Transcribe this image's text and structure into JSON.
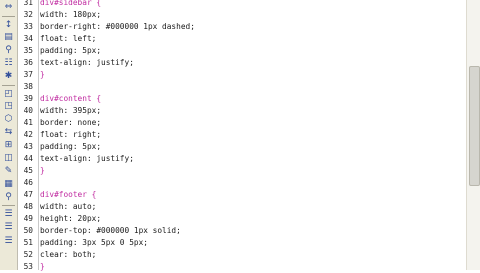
{
  "toolbar": {
    "icons": [
      {
        "name": "expand-icon",
        "glyph": "⇔"
      },
      {
        "name": "collapse-icon",
        "glyph": "↕"
      },
      {
        "name": "select-icon",
        "glyph": "▤"
      },
      {
        "name": "link-icon",
        "glyph": "⚲"
      },
      {
        "name": "wrap-icon",
        "glyph": "☷"
      },
      {
        "name": "indent-icon",
        "glyph": "✱"
      },
      {
        "name": "comment-icon",
        "glyph": "◰"
      },
      {
        "name": "uncomment-icon",
        "glyph": "◳"
      },
      {
        "name": "snippet-icon",
        "glyph": "⬡"
      },
      {
        "name": "highlight-icon",
        "glyph": "⇆"
      },
      {
        "name": "format-icon",
        "glyph": "⊞"
      },
      {
        "name": "apply-icon",
        "glyph": "◫"
      },
      {
        "name": "edit-icon",
        "glyph": "✎"
      },
      {
        "name": "validate-icon",
        "glyph": "▦"
      },
      {
        "name": "search-icon",
        "glyph": "⚲"
      },
      {
        "name": "outdent-icon",
        "glyph": "☰"
      },
      {
        "name": "indent-more-icon",
        "glyph": "☰"
      },
      {
        "name": "list-icon",
        "glyph": "☰"
      }
    ]
  },
  "editor": {
    "lines": [
      {
        "num": "31",
        "text": "div#sidebar {",
        "kind": "selector"
      },
      {
        "num": "32",
        "text": "width: 180px;",
        "kind": "prop"
      },
      {
        "num": "33",
        "text": "border-right: #000000 1px dashed;",
        "kind": "prop"
      },
      {
        "num": "34",
        "text": "float: left;",
        "kind": "prop"
      },
      {
        "num": "35",
        "text": "padding: 5px;",
        "kind": "prop"
      },
      {
        "num": "36",
        "text": "text-align: justify;",
        "kind": "prop"
      },
      {
        "num": "37",
        "text": "}",
        "kind": "brace"
      },
      {
        "num": "38",
        "text": "",
        "kind": "prop"
      },
      {
        "num": "39",
        "text": "div#content {",
        "kind": "selector"
      },
      {
        "num": "40",
        "text": "width: 395px;",
        "kind": "prop"
      },
      {
        "num": "41",
        "text": "border: none;",
        "kind": "prop"
      },
      {
        "num": "42",
        "text": "float: right;",
        "kind": "prop"
      },
      {
        "num": "43",
        "text": "padding: 5px;",
        "kind": "prop"
      },
      {
        "num": "44",
        "text": "text-align: justify;",
        "kind": "prop"
      },
      {
        "num": "45",
        "text": "}",
        "kind": "brace"
      },
      {
        "num": "46",
        "text": "",
        "kind": "prop"
      },
      {
        "num": "47",
        "text": "div#footer {",
        "kind": "selector"
      },
      {
        "num": "48",
        "text": "width: auto;",
        "kind": "prop"
      },
      {
        "num": "49",
        "text": "height: 20px;",
        "kind": "prop"
      },
      {
        "num": "50",
        "text": "border-top: #000000 1px solid;",
        "kind": "prop"
      },
      {
        "num": "51",
        "text": "padding: 3px 5px 0 5px;",
        "kind": "prop"
      },
      {
        "num": "52",
        "text": "clear: both;",
        "kind": "prop"
      },
      {
        "num": "53",
        "text": "}",
        "kind": "brace"
      }
    ]
  },
  "colors": {
    "selector": "#c02aa0",
    "property": "#1a1a1a",
    "toolbar_bg": "#ece9d8"
  }
}
